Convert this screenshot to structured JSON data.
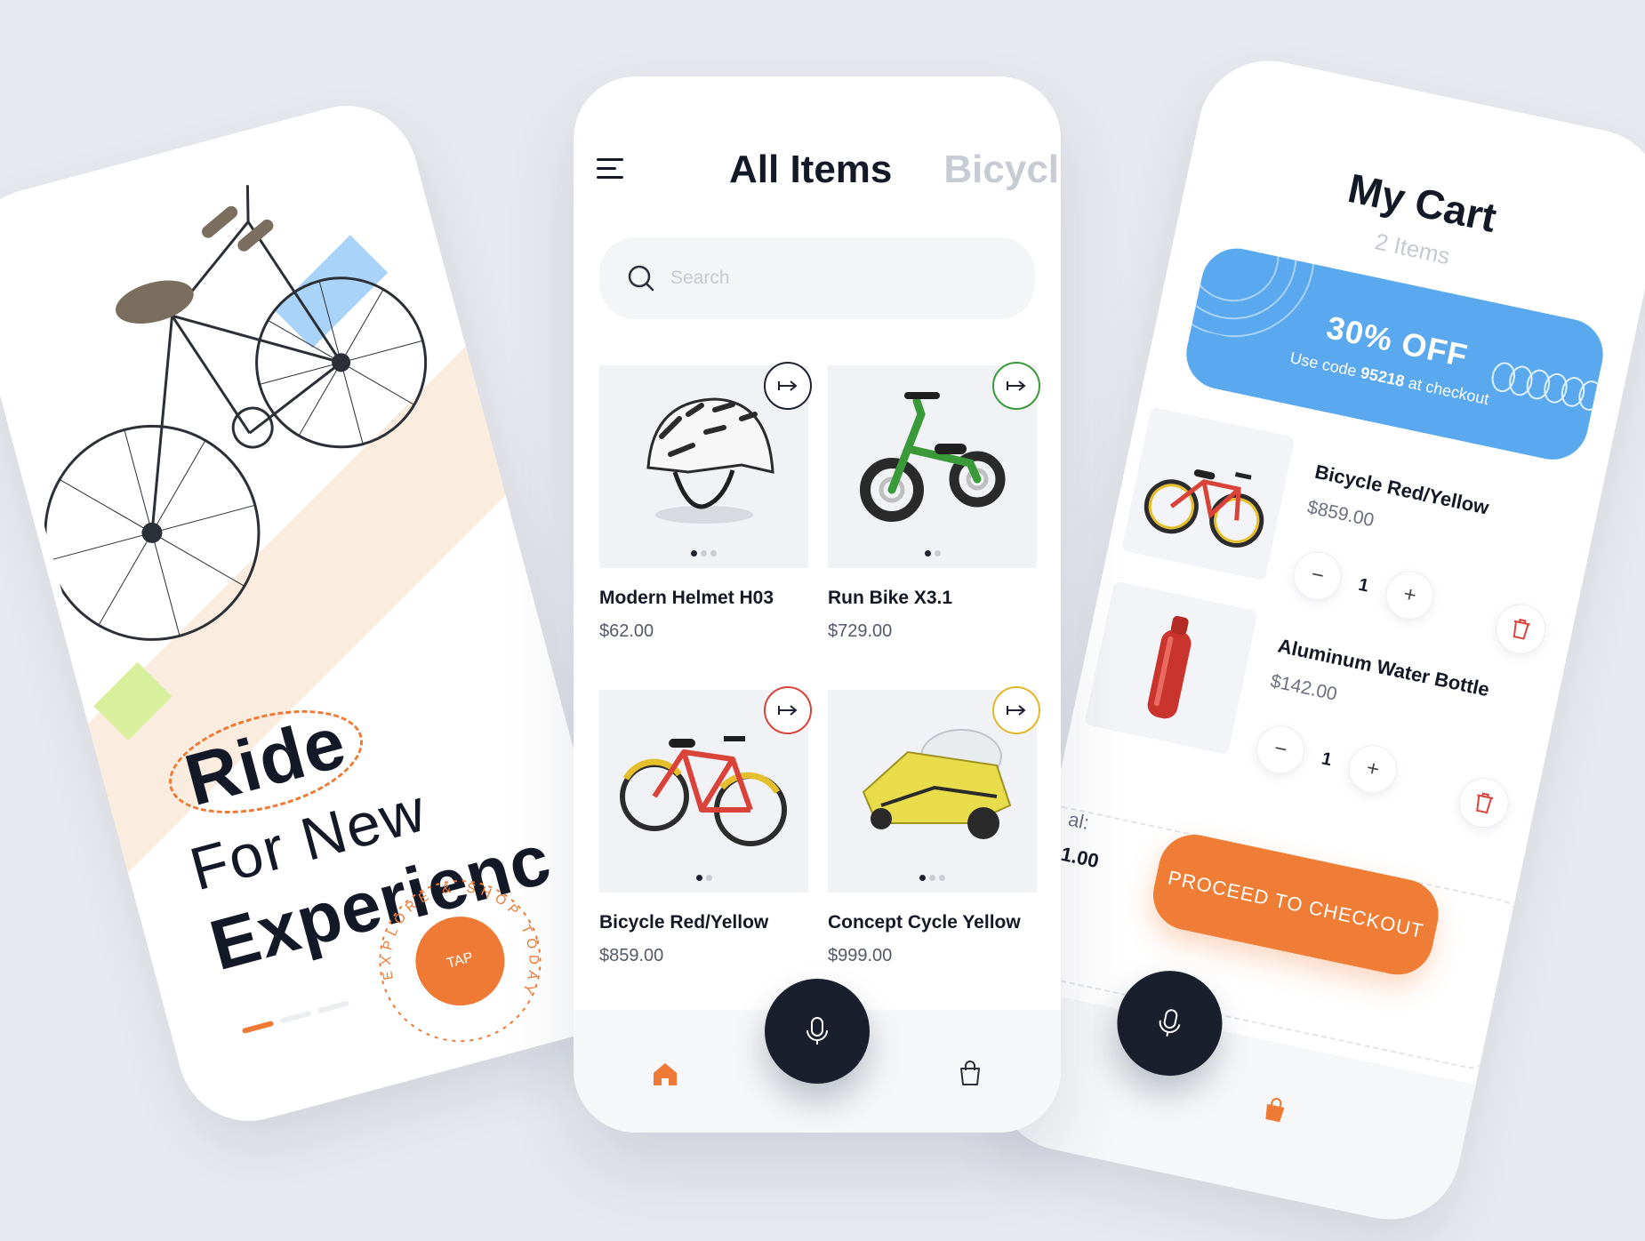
{
  "colors": {
    "accent_orange": "#ee7a35",
    "promo_blue": "#5aa9ee",
    "dark": "#1a1f2d",
    "background": "#e7e9ee"
  },
  "onboarding": {
    "headline_word1": "Ride",
    "headline_line2": "For New",
    "headline_line3": "Experienc",
    "tap_label": "TAP",
    "circular_text": "EXPLORE & SHOP TODAY",
    "pager_total": 3,
    "pager_active": 1
  },
  "catalog": {
    "tabs": [
      {
        "label": "All Items",
        "active": true
      },
      {
        "label": "Bicycl",
        "active": false
      }
    ],
    "search": {
      "placeholder": "Search",
      "value": ""
    },
    "products": [
      {
        "name": "Modern Helmet H03",
        "price": "$62.00",
        "arrow_color": "#1d2130",
        "image": "helmet",
        "dots": 3,
        "active_dot": 0
      },
      {
        "name": "Run Bike X3.1",
        "price": "$729.00",
        "arrow_color": "#3a9a3a",
        "image": "run-bike",
        "dots": 2,
        "active_dot": 0
      },
      {
        "name": "Bicycle Red/Yellow",
        "price": "$859.00",
        "arrow_color": "#d9433a",
        "image": "red-bicycle",
        "dots": 2,
        "active_dot": 0
      },
      {
        "name": "Concept Cycle Yellow",
        "price": "$999.00",
        "arrow_color": "#e0b92a",
        "image": "concept-cycle",
        "dots": 3,
        "active_dot": 0
      }
    ],
    "nav": {
      "home_icon": "home-icon",
      "mic_icon": "mic-icon",
      "bag_icon": "bag-icon"
    }
  },
  "cart": {
    "title": "My Cart",
    "subtitle": "2 Items",
    "promo": {
      "title": "30% OFF",
      "text_before": "Use code",
      "code": "95218",
      "text_after": "at checkout"
    },
    "items": [
      {
        "name": "Bicycle Red/Yellow",
        "price": "$859.00",
        "qty": "1"
      },
      {
        "name": "Aluminum Water Bottle",
        "price": "$142.00",
        "qty": "1"
      }
    ],
    "total_label": "al:",
    "total_value": "1.00",
    "checkout_label": "PROCEED TO CHECKOUT"
  }
}
